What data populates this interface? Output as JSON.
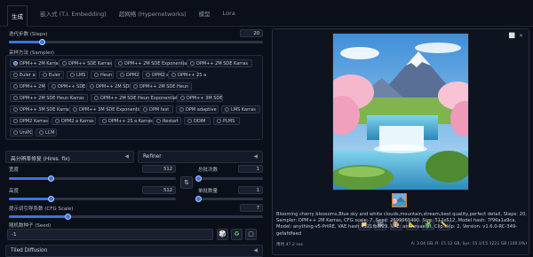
{
  "tabs": [
    "生成",
    "嵌入式 (T.I. Embedding)",
    "超网络 (Hypernetworks)",
    "模型",
    "Lora"
  ],
  "steps": {
    "label": "迭代步数 (Steps)",
    "value": "20",
    "fraction": 0.13
  },
  "sampler": {
    "label": "采样方法 (Sampler)",
    "selected": "DPM++ 2M Karras",
    "options": [
      "DPM++ 2M Karras",
      "DPM++ SDE Karras",
      "DPM++ 2M SDE Exponential",
      "DPM++ 2M SDE Karras",
      "Euler a",
      "Euler",
      "LMS",
      "Heun",
      "DPM2",
      "DPM2 a",
      "DPM++ 2S a",
      "DPM++ 2M",
      "DPM++ SDE",
      "DPM++ 2M SDE",
      "DPM++ 2M SDE Heun",
      "DPM++ 2M SDE Heun Karras",
      "DPM++ 2M SDE Heun Exponential",
      "DPM++ 3M SDE",
      "DPM++ 3M SDE Karras",
      "DPM++ 3M SDE Exponential",
      "DPM fast",
      "DPM adaptive",
      "LMS Karras",
      "DPM2 Karras",
      "DPM2 a Karras",
      "DPM++ 2S a Karras",
      "Restart",
      "DDIM",
      "PLMS",
      "UniPC",
      "LCM"
    ]
  },
  "hires": {
    "label": "高分辨率修复 (Hires. fix)",
    "caret": "◀"
  },
  "refiner": {
    "label": "Refiner",
    "caret": "◀"
  },
  "width": {
    "label": "宽度",
    "value": "512",
    "fraction": 0.25
  },
  "height": {
    "label": "高度",
    "value": "512",
    "fraction": 0.25
  },
  "batch_count": {
    "label": "总批次数",
    "value": "1",
    "fraction": 0.0
  },
  "batch_size": {
    "label": "单批数量",
    "value": "1",
    "fraction": 0.0
  },
  "swap_icon": "⇅",
  "cfg": {
    "label": "提示词引导系数 (CFG Scale)",
    "value": "7",
    "fraction": 0.23
  },
  "seed": {
    "label": "随机数种子 (Seed)",
    "value": "-1"
  },
  "seed_buttons": [
    "🎲",
    "♻",
    "▢"
  ],
  "tiled": {
    "label": "Tiled Diffusion",
    "caret": "◀"
  },
  "output": {
    "top_icons": [
      "⬜",
      "✕"
    ],
    "tool_icons": [
      "📁",
      "🖼",
      "🎨",
      "📐",
      "🧩",
      "📏"
    ],
    "info": "Blooming cherry blossoms,Blue sky and white clouds,mountain,stream,best quality,perfect detail, Steps: 20, Sampler: DPM++ 2M Karras, CFG scale: 7, Seed: 2699965490, Size: 512x512, Model hash: 7f96a1a9ca, Model: anything-v5-PrtRE, VAE hash: f921fb3f29, VAE: animevae.pt, Clip skip: 2, Version: v1.6.0-RC-349-gefafdfaed",
    "time": "用时 47.2 sec.",
    "vram": "A: 3.04 GB, R: 15.12 GB, Sys: 15.1/15.1221 GB (100.0%)"
  },
  "colors": {
    "accent": "#3b74e0",
    "bg": "#0b0f19"
  }
}
